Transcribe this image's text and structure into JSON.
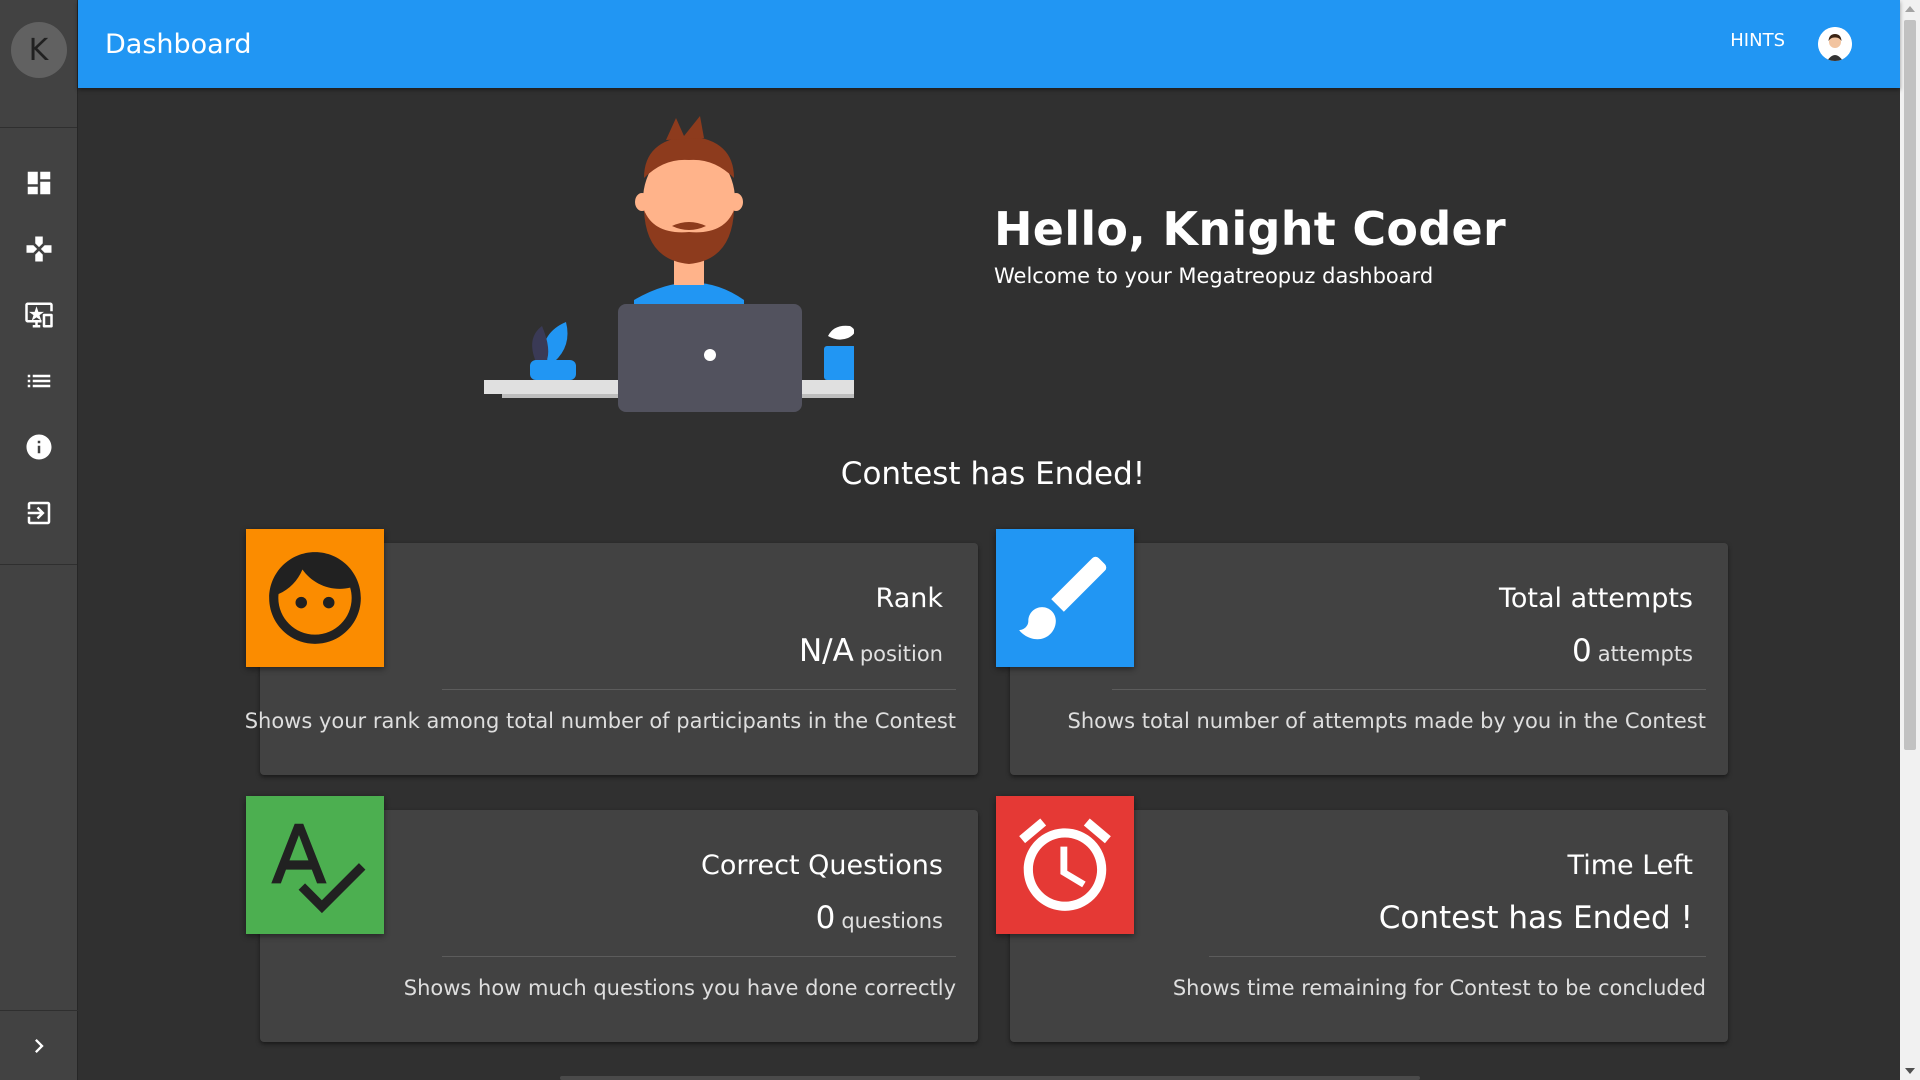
{
  "sidebar": {
    "avatar_letter": "K",
    "items": [
      {
        "name": "dashboard-icon"
      },
      {
        "name": "gamepad-icon"
      },
      {
        "name": "monitor-star-icon"
      },
      {
        "name": "list-icon"
      },
      {
        "name": "info-icon"
      },
      {
        "name": "exit-icon"
      }
    ],
    "collapse_icon": "chevron-right-icon"
  },
  "appbar": {
    "title": "Dashboard",
    "hints_label": "HINTS",
    "color": "#2196f3"
  },
  "hero": {
    "greeting": "Hello, Knight Coder",
    "subtitle": "Welcome to your Megatreopuz dashboard"
  },
  "contest_status": "Contest has Ended!",
  "cards": {
    "rank": {
      "title": "Rank",
      "value": "N/A",
      "unit": "position",
      "description": "Shows your rank among total number of participants in the Contest",
      "icon": "face-icon",
      "color": "#fb8c00"
    },
    "attempts": {
      "title": "Total attempts",
      "value": "0",
      "unit": "attempts",
      "description": "Shows total number of attempts made by you in the Contest",
      "icon": "brush-icon",
      "color": "#2196f3"
    },
    "correct": {
      "title": "Correct Questions",
      "value": "0",
      "unit": "questions",
      "description": "Shows how much questions you have done correctly",
      "icon": "spellcheck-icon",
      "color": "#4caf50"
    },
    "time": {
      "title": "Time Left",
      "value": "Contest has Ended !",
      "description": "Shows time remaining for Contest to be concluded",
      "icon": "alarm-icon",
      "color": "#e53935"
    }
  }
}
